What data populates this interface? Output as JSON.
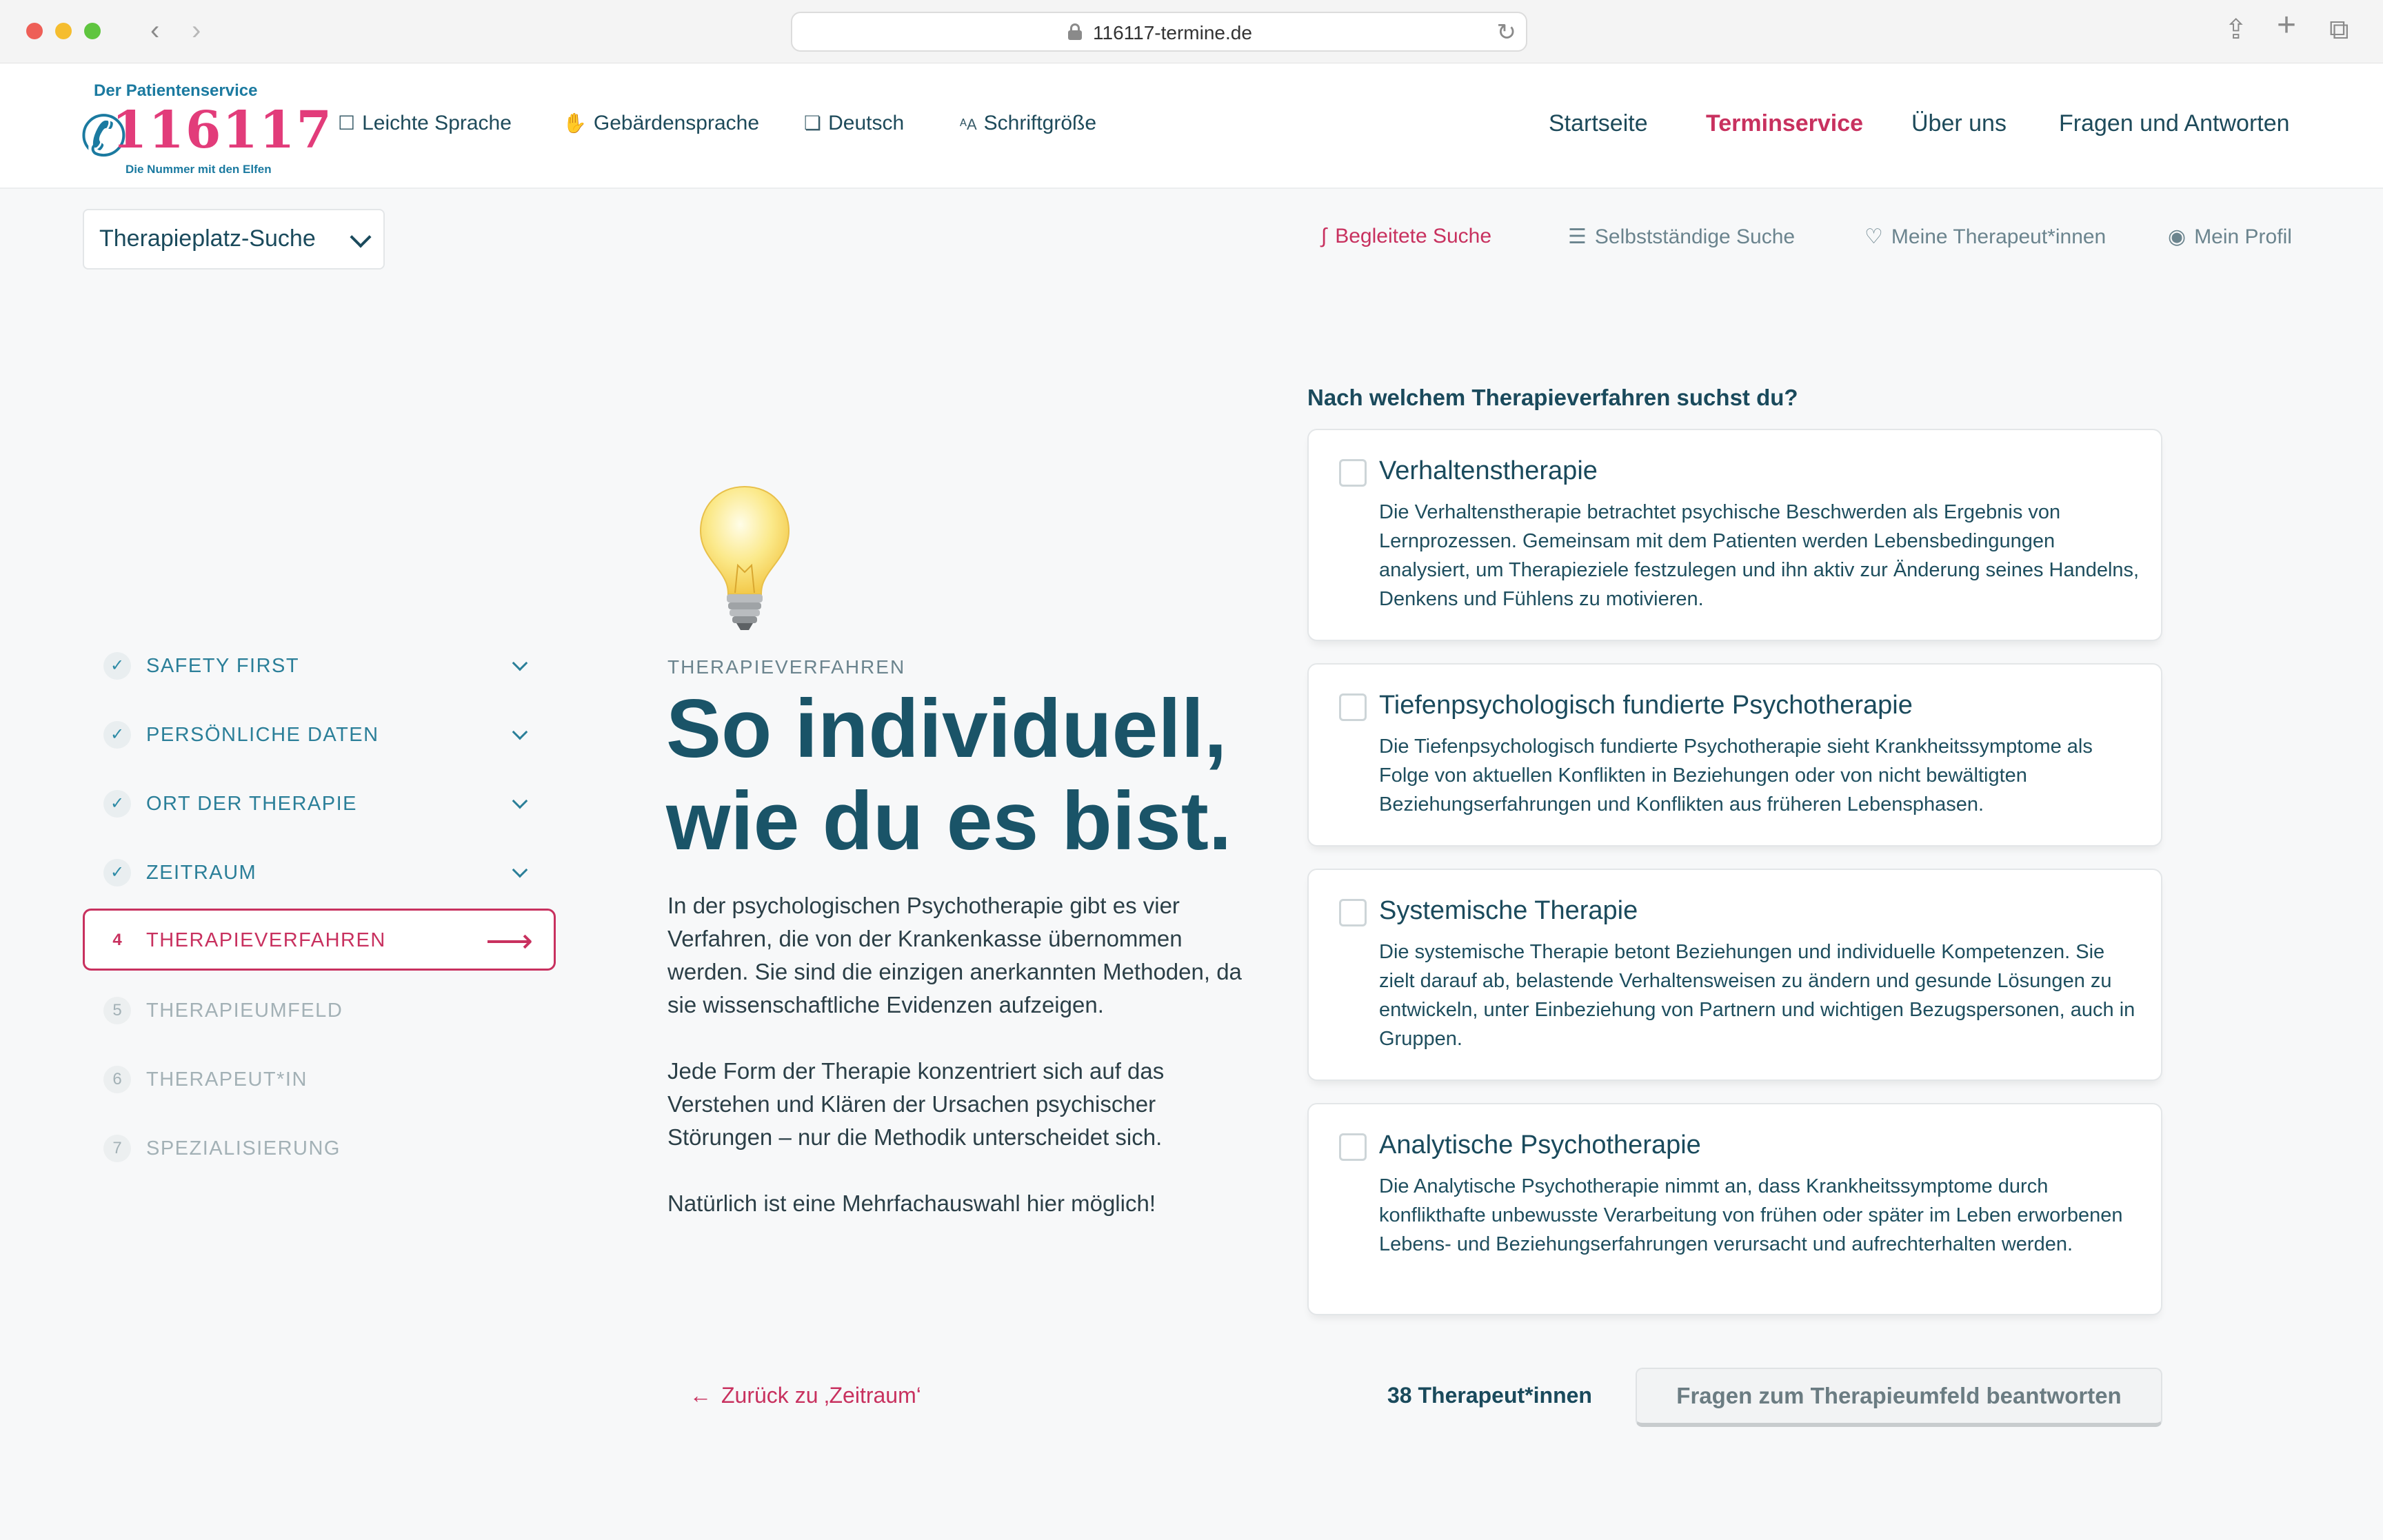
{
  "browser": {
    "url": "116117-termine.de"
  },
  "header": {
    "logo": {
      "top_line": "Der Patientenservice",
      "number": "116117",
      "tagline": "Die Nummer mit den Elfen"
    },
    "utility_links": [
      "Leichte Sprache",
      "Gebärdensprache",
      "Deutsch",
      "Schriftgröße"
    ],
    "main_nav": [
      "Startseite",
      "Terminservice",
      "Über uns",
      "Fragen und Antworten"
    ],
    "active_nav": "Terminservice"
  },
  "subheader": {
    "dropdown_label": "Therapieplatz-Suche",
    "tabs": [
      "Begleitete Suche",
      "Selbstständige Suche",
      "Meine Therapeut*innen",
      "Mein Profil"
    ],
    "active_tab": "Begleitete Suche"
  },
  "steps": [
    {
      "badge": "✓",
      "label": "SAFETY FIRST",
      "state": "done"
    },
    {
      "badge": "✓",
      "label": "PERSÖNLICHE DATEN",
      "state": "done"
    },
    {
      "badge": "✓",
      "label": "ORT DER THERAPIE",
      "state": "done"
    },
    {
      "badge": "✓",
      "label": "ZEITRAUM",
      "state": "done"
    },
    {
      "badge": "4",
      "label": "THERAPIEVERFAHREN",
      "state": "active"
    },
    {
      "badge": "5",
      "label": "THERAPIEUMFELD",
      "state": "future"
    },
    {
      "badge": "6",
      "label": "THERAPEUT*IN",
      "state": "future"
    },
    {
      "badge": "7",
      "label": "SPEZIALISIERUNG",
      "state": "future"
    }
  ],
  "intro": {
    "eyebrow": "THERAPIEVERFAHREN",
    "headline": "So individuell, wie du es bist.",
    "paragraphs": [
      "In der psychologischen Psychotherapie gibt es vier Verfahren, die von der Krankenkasse übernommen werden. Sie sind die einzigen anerkannten Methoden, da sie wissenschaftliche Evidenzen aufzeigen.",
      "Jede Form der Therapie konzentriert sich auf das Verstehen und Klären der Ursachen psychischer Störungen – nur die Methodik unterscheidet sich.",
      "Natürlich ist eine Mehrfachauswahl hier möglich!"
    ]
  },
  "question": "Nach welchem Therapieverfahren suchst du?",
  "options": [
    {
      "title": "Verhaltenstherapie",
      "description": "Die Verhaltenstherapie betrachtet psychische Beschwerden als Ergebnis von Lernprozessen. Gemeinsam mit dem Patienten werden Lebensbedingungen analysiert, um Therapieziele festzulegen und ihn aktiv zur Änderung seines Handelns, Denkens und Fühlens zu motivieren.",
      "checked": false
    },
    {
      "title": "Tiefenpsychologisch fundierte Psychotherapie",
      "description": "Die Tiefenpsychologisch fundierte Psychotherapie sieht Krankheitssymptome als Folge von aktuellen Konflikten in Beziehungen oder von nicht bewältigten Beziehungserfahrungen und Konflikten aus früheren Lebensphasen.",
      "checked": false
    },
    {
      "title": "Systemische Therapie",
      "description": "Die systemische Therapie betont Beziehungen und individuelle Kompetenzen. Sie zielt darauf ab, belastende Verhaltensweisen zu ändern und gesunde Lösungen zu entwickeln, unter Einbeziehung von Partnern und wichtigen Bezugspersonen, auch in Gruppen.",
      "checked": false
    },
    {
      "title": "Analytische Psychotherapie",
      "description": "Die Analytische Psychotherapie nimmt an, dass Krankheitssymptome durch konflikthafte unbewusste Verarbeitung von frühen oder später im Leben erworbenen Lebens- und Beziehungserfahrungen verursacht und aufrechterhalten werden.",
      "checked": false
    }
  ],
  "footer": {
    "back_label": "Zurück zu ‚Zeitraum‘",
    "count_label": "38 Therapeut*innen",
    "next_label": "Fragen zum Therapieumfeld beantworten"
  },
  "colors": {
    "accent": "#c8315f",
    "primary_text": "#1a4a5c",
    "step_done": "#2b7f99",
    "step_future": "#a3b1b6",
    "background": "#f7f8f9"
  },
  "icons": {
    "url_lock": "lock-icon",
    "reload": "reload-icon",
    "share": "share-icon",
    "new_tab": "plus-icon",
    "tab_overview": "tabs-icon",
    "bulb": "lightbulb-icon"
  }
}
